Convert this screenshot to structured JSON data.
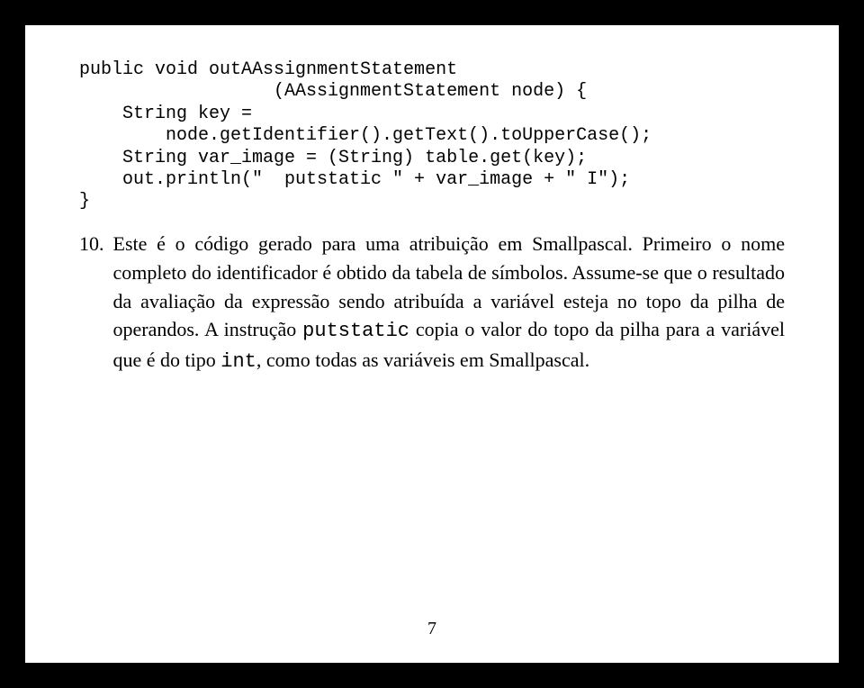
{
  "code": {
    "l1": "public void outAAssignmentStatement",
    "l2": "                  (AAssignmentStatement node) {",
    "l3": "    String key =",
    "l4": "        node.getIdentifier().getText().toUpperCase();",
    "l5": "    String var_image = (String) table.get(key);",
    "l6": "    out.println(\"  putstatic \" + var_image + \" I\");",
    "l7": "}"
  },
  "list": {
    "marker": "10.",
    "t1": "Este é o código gerado para uma atribuição em Smallpascal. Primeiro o nome completo do identificador é obtido da tabela de símbolos. Assume-se que o resultado da avaliação da expressão sendo atribuída a variável esteja no topo da pilha de operandos. A instrução ",
    "mono1": "putstatic",
    "t2": " copia o valor do topo da pilha para a variável que é do tipo ",
    "mono2": "int",
    "t3": ", como todas as variáveis em Smallpascal."
  },
  "page_number": "7"
}
